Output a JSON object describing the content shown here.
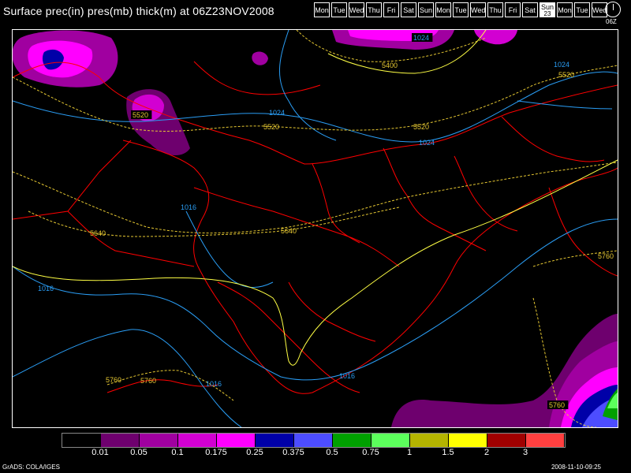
{
  "title": "Surface prec(in) pres(mb) thick(m) at 06Z23NOV2008",
  "days": [
    {
      "label": "Mon"
    },
    {
      "label": "Tue"
    },
    {
      "label": "Wed"
    },
    {
      "label": "Thu"
    },
    {
      "label": "Fri"
    },
    {
      "label": "Sat"
    },
    {
      "label": "Sun"
    },
    {
      "label": "Mon"
    },
    {
      "label": "Tue"
    },
    {
      "label": "Wed"
    },
    {
      "label": "Thu"
    },
    {
      "label": "Fri"
    },
    {
      "label": "Sat"
    },
    {
      "label": "Sun",
      "sub": "23",
      "active": true
    },
    {
      "label": "Mon"
    },
    {
      "label": "Tue"
    },
    {
      "label": "Wed"
    }
  ],
  "clock_label": "06Z",
  "contour_labels": {
    "pressure": [
      "1024",
      "1024",
      "1024",
      "1024",
      "1016",
      "1016",
      "1016",
      "1016"
    ],
    "thickness": [
      "5400",
      "5520",
      "5520",
      "5520",
      "5520",
      "5640",
      "5640",
      "5760",
      "5760",
      "5760",
      "5760"
    ]
  },
  "colorbar": {
    "colors": [
      "#000000",
      "#6e006e",
      "#a000a0",
      "#d200d2",
      "#ff00ff",
      "#0000a8",
      "#4d4dff",
      "#00a000",
      "#5cff5c",
      "#b4b400",
      "#ffff00",
      "#a00000",
      "#ff4040"
    ],
    "labels": [
      "0.01",
      "0.05",
      "0.1",
      "0.175",
      "0.25",
      "0.375",
      "0.5",
      "0.75",
      "1",
      "1.5",
      "2",
      "3"
    ]
  },
  "colors": {
    "borders": "#ff0000",
    "pressure_contours": "#2a9df4",
    "thickness_contours": "#e6c832"
  },
  "footer_left": "GrADS: COLA/IGES",
  "footer_right": "2008-11-10-09:25"
}
